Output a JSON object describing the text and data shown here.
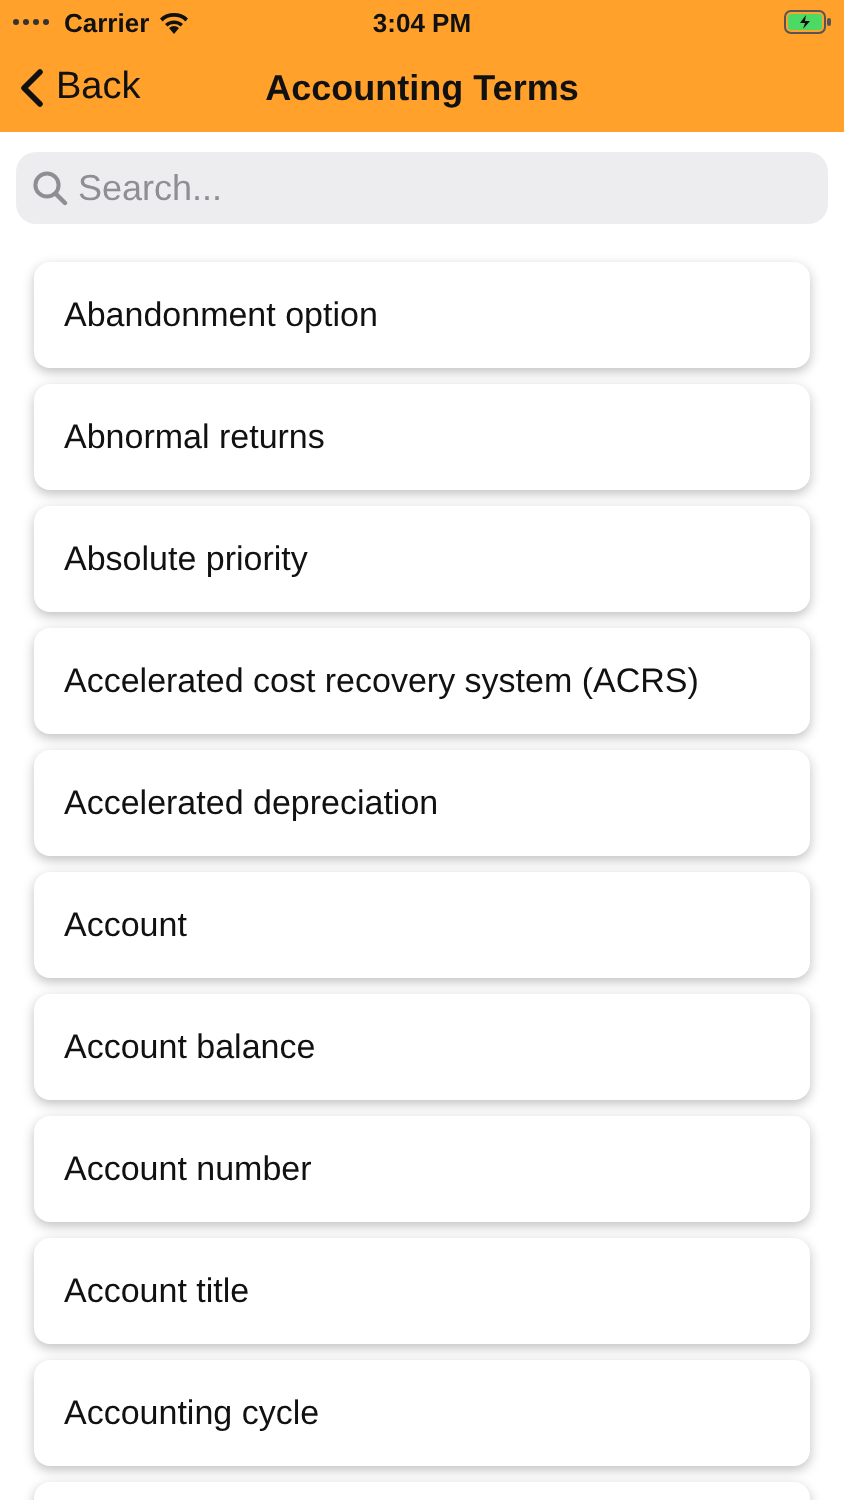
{
  "status_bar": {
    "carrier": "Carrier",
    "time": "3:04 PM"
  },
  "nav_bar": {
    "back": "Back",
    "title": "Accounting Terms"
  },
  "search": {
    "placeholder": "Search..."
  },
  "terms": [
    {
      "label": "Abandonment option"
    },
    {
      "label": "Abnormal returns"
    },
    {
      "label": "Absolute priority"
    },
    {
      "label": "Accelerated cost recovery system (ACRS)"
    },
    {
      "label": "Accelerated depreciation"
    },
    {
      "label": "Account"
    },
    {
      "label": "Account balance"
    },
    {
      "label": "Account number"
    },
    {
      "label": "Account title"
    },
    {
      "label": "Accounting cycle"
    }
  ]
}
